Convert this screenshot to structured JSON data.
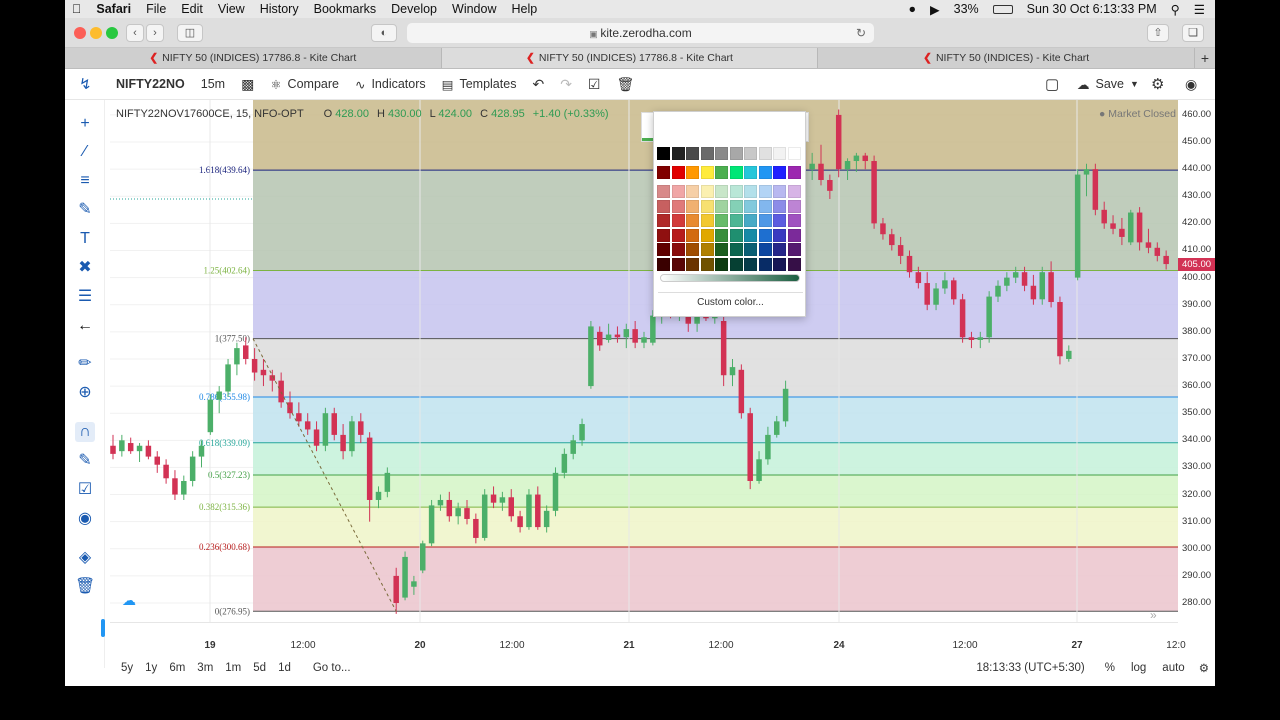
{
  "menubar": {
    "apple": "",
    "app": "Safari",
    "items": [
      "File",
      "Edit",
      "View",
      "History",
      "Bookmarks",
      "Develop",
      "Window",
      "Help"
    ],
    "battery": "33%",
    "datetime": "Sun 30 Oct  6:13:33 PM"
  },
  "browser": {
    "url": "kite.zerodha.com",
    "tabs": [
      {
        "label": "NIFTY 50 (INDICES) 17786.8 - Kite Chart"
      },
      {
        "label": "NIFTY 50 (INDICES) 17786.8 - Kite Chart"
      },
      {
        "label": "NIFTY 50 (INDICES) - Kite Chart"
      }
    ]
  },
  "toolbar": {
    "symbol": "NIFTY22NO",
    "interval": "15m",
    "compare": "Compare",
    "indicators": "Indicators",
    "templates": "Templates",
    "save": "Save"
  },
  "legend": {
    "instrument": "NIFTY22NOV17600CE, 15, NFO-OPT",
    "o_label": "O",
    "o": "428.00",
    "h_label": "H",
    "h": "430.00",
    "l_label": "L",
    "l": "424.00",
    "c_label": "C",
    "c": "428.95",
    "change": "+1.40 (+0.33%)",
    "status": "Market Closed"
  },
  "fib_levels": [
    {
      "ratio": "1.618",
      "price": 439.64,
      "label": "1.618(439.64)",
      "color": "#1a237e",
      "fill": "#c8b98a"
    },
    {
      "ratio": "1.25",
      "price": 402.64,
      "label": "1.25(402.64)",
      "color": "#7cb342",
      "fill": "#b5c4b0"
    },
    {
      "ratio": "1",
      "price": 377.5,
      "label": "1(377.50)",
      "color": "#555555",
      "fill": "#c5c3ef"
    },
    {
      "ratio": "0.786",
      "price": 355.98,
      "label": "0.786(355.98)",
      "color": "#1e88e5",
      "fill": "#dcdcdc"
    },
    {
      "ratio": "0.618",
      "price": 339.09,
      "label": "0.618(339.09)",
      "color": "#26a69a",
      "fill": "#bfe3ee"
    },
    {
      "ratio": "0.5",
      "price": 327.23,
      "label": "0.5(327.23)",
      "color": "#43a047",
      "fill": "#c4f1d9"
    },
    {
      "ratio": "0.382",
      "price": 315.36,
      "label": "0.382(315.36)",
      "color": "#7cb342",
      "fill": "#d3f5c6"
    },
    {
      "ratio": "0.236",
      "price": 300.68,
      "label": "0.236(300.68)",
      "color": "#b71c1c",
      "fill": "#eef5c8"
    },
    {
      "ratio": "0",
      "price": 276.95,
      "label": "0(276.95)",
      "color": "#555555",
      "fill": "#ebc4cc"
    }
  ],
  "price_axis": [
    "460.00",
    "450.00",
    "440.00",
    "430.00",
    "420.00",
    "410.00",
    "400.00",
    "390.00",
    "380.00",
    "370.00",
    "360.00",
    "350.00",
    "340.00",
    "330.00",
    "320.00",
    "310.00",
    "300.00",
    "290.00",
    "280.00"
  ],
  "current_price": "405.00",
  "time_axis": [
    "19",
    "12:00",
    "20",
    "12:00",
    "21",
    "12:00",
    "24",
    "12:00",
    "27",
    "12:0"
  ],
  "bottom": {
    "ranges": [
      "5y",
      "1y",
      "6m",
      "3m",
      "1m",
      "5d",
      "1d"
    ],
    "goto": "Go to...",
    "clock": "18:13:33 (UTC+5:30)",
    "pct": "%",
    "log": "log",
    "auto": "auto"
  },
  "palette": {
    "custom": "Custom color...",
    "grays": [
      "#000000",
      "#222222",
      "#4a4a4a",
      "#6a6a6a",
      "#8a8a8a",
      "#a8a8a8",
      "#c8c8c8",
      "#e0e0e0",
      "#f2f2f2",
      "#ffffff"
    ],
    "main": [
      "#800000",
      "#e00000",
      "#ff9800",
      "#ffeb3b",
      "#4caf50",
      "#00e676",
      "#26c6da",
      "#2196f3",
      "#2020ff",
      "#9c27b0",
      "#e040fb"
    ],
    "shades": [
      [
        "#d88a8a",
        "#f0a6a6",
        "#f6cfa6",
        "#fbf0b0",
        "#c8e6c9",
        "#b9e7d7",
        "#b3e0ea",
        "#b3d4f5",
        "#b8b8f0",
        "#d7b4e6"
      ],
      [
        "#c76060",
        "#e07a7a",
        "#f0b070",
        "#f7e070",
        "#9fd39f",
        "#84d0b6",
        "#82c9dd",
        "#82b7ee",
        "#8c8ce8",
        "#bd84d4"
      ],
      [
        "#b02a2a",
        "#d23a3a",
        "#e88a30",
        "#f2c830",
        "#66bb6a",
        "#4db694",
        "#48aac6",
        "#4f98e6",
        "#5c5ce0",
        "#a052c0"
      ],
      [
        "#8f1010",
        "#b71c1c",
        "#d26a10",
        "#e0a800",
        "#388e3c",
        "#1f8f70",
        "#178aa6",
        "#1e6fd0",
        "#3a3ac0",
        "#7b2a9a"
      ],
      [
        "#600000",
        "#8a0c0c",
        "#a04d00",
        "#b08000",
        "#1b5e20",
        "#0d6650",
        "#0a5f75",
        "#0d47a1",
        "#26268a",
        "#551a70"
      ],
      [
        "#3a0000",
        "#5a0606",
        "#6a3300",
        "#705200",
        "#0d3b10",
        "#064033",
        "#063c4a",
        "#082c66",
        "#161655",
        "#360f47"
      ]
    ]
  },
  "candles": [
    {
      "t": 0,
      "o": 338,
      "h": 342,
      "l": 333,
      "c": 335
    },
    {
      "t": 1,
      "o": 336,
      "h": 342,
      "l": 334,
      "c": 340
    },
    {
      "t": 2,
      "o": 339,
      "h": 341,
      "l": 335,
      "c": 336
    },
    {
      "t": 3,
      "o": 336,
      "h": 339,
      "l": 332,
      "c": 338
    },
    {
      "t": 4,
      "o": 338,
      "h": 340,
      "l": 333,
      "c": 334
    },
    {
      "t": 5,
      "o": 334,
      "h": 336,
      "l": 328,
      "c": 331
    },
    {
      "t": 6,
      "o": 331,
      "h": 333,
      "l": 324,
      "c": 326
    },
    {
      "t": 7,
      "o": 326,
      "h": 329,
      "l": 318,
      "c": 320
    },
    {
      "t": 8,
      "o": 320,
      "h": 327,
      "l": 318,
      "c": 325
    },
    {
      "t": 9,
      "o": 325,
      "h": 336,
      "l": 323,
      "c": 334
    },
    {
      "t": 10,
      "o": 334,
      "h": 340,
      "l": 330,
      "c": 338
    },
    {
      "t": 11,
      "o": 343,
      "h": 357,
      "l": 342,
      "c": 355
    },
    {
      "t": 12,
      "o": 355,
      "h": 360,
      "l": 350,
      "c": 358
    },
    {
      "t": 13,
      "o": 358,
      "h": 370,
      "l": 356,
      "c": 368
    },
    {
      "t": 14,
      "o": 368,
      "h": 376,
      "l": 364,
      "c": 374
    },
    {
      "t": 15,
      "o": 375,
      "h": 378,
      "l": 368,
      "c": 370
    },
    {
      "t": 16,
      "o": 370,
      "h": 374,
      "l": 362,
      "c": 365
    },
    {
      "t": 17,
      "o": 366,
      "h": 370,
      "l": 360,
      "c": 364
    },
    {
      "t": 18,
      "o": 364,
      "h": 366,
      "l": 358,
      "c": 362
    },
    {
      "t": 19,
      "o": 362,
      "h": 365,
      "l": 352,
      "c": 354
    },
    {
      "t": 20,
      "o": 354,
      "h": 358,
      "l": 348,
      "c": 350
    },
    {
      "t": 21,
      "o": 350,
      "h": 354,
      "l": 345,
      "c": 347
    },
    {
      "t": 22,
      "o": 347,
      "h": 350,
      "l": 342,
      "c": 344
    },
    {
      "t": 23,
      "o": 344,
      "h": 347,
      "l": 336,
      "c": 338
    },
    {
      "t": 24,
      "o": 338,
      "h": 352,
      "l": 336,
      "c": 350
    },
    {
      "t": 25,
      "o": 350,
      "h": 352,
      "l": 340,
      "c": 342
    },
    {
      "t": 26,
      "o": 342,
      "h": 346,
      "l": 333,
      "c": 336
    },
    {
      "t": 27,
      "o": 336,
      "h": 349,
      "l": 334,
      "c": 347
    },
    {
      "t": 28,
      "o": 347,
      "h": 350,
      "l": 339,
      "c": 342
    },
    {
      "t": 29,
      "o": 341,
      "h": 343,
      "l": 310,
      "c": 318
    },
    {
      "t": 30,
      "o": 318,
      "h": 323,
      "l": 315,
      "c": 321
    },
    {
      "t": 31,
      "o": 321,
      "h": 330,
      "l": 319,
      "c": 328
    },
    {
      "t": 32,
      "o": 290,
      "h": 293,
      "l": 276,
      "c": 280
    },
    {
      "t": 33,
      "o": 282,
      "h": 299,
      "l": 281,
      "c": 297
    },
    {
      "t": 34,
      "o": 286,
      "h": 290,
      "l": 283,
      "c": 288
    },
    {
      "t": 35,
      "o": 292,
      "h": 303,
      "l": 291,
      "c": 302
    },
    {
      "t": 36,
      "o": 302,
      "h": 318,
      "l": 301,
      "c": 316
    },
    {
      "t": 37,
      "o": 316,
      "h": 320,
      "l": 314,
      "c": 318
    },
    {
      "t": 38,
      "o": 318,
      "h": 321,
      "l": 310,
      "c": 312
    },
    {
      "t": 39,
      "o": 312,
      "h": 317,
      "l": 309,
      "c": 315
    },
    {
      "t": 40,
      "o": 315,
      "h": 318,
      "l": 309,
      "c": 311
    },
    {
      "t": 41,
      "o": 311,
      "h": 313,
      "l": 302,
      "c": 304
    },
    {
      "t": 42,
      "o": 304,
      "h": 322,
      "l": 303,
      "c": 320
    },
    {
      "t": 43,
      "o": 320,
      "h": 323,
      "l": 315,
      "c": 317
    },
    {
      "t": 44,
      "o": 317,
      "h": 321,
      "l": 314,
      "c": 319
    },
    {
      "t": 45,
      "o": 319,
      "h": 322,
      "l": 310,
      "c": 312
    },
    {
      "t": 46,
      "o": 312,
      "h": 314,
      "l": 306,
      "c": 308
    },
    {
      "t": 47,
      "o": 308,
      "h": 322,
      "l": 307,
      "c": 320
    },
    {
      "t": 48,
      "o": 320,
      "h": 323,
      "l": 307,
      "c": 308
    },
    {
      "t": 49,
      "o": 308,
      "h": 316,
      "l": 306,
      "c": 314
    },
    {
      "t": 50,
      "o": 314,
      "h": 330,
      "l": 312,
      "c": 328
    },
    {
      "t": 51,
      "o": 328,
      "h": 337,
      "l": 326,
      "c": 335
    },
    {
      "t": 52,
      "o": 335,
      "h": 342,
      "l": 333,
      "c": 340
    },
    {
      "t": 53,
      "o": 340,
      "h": 348,
      "l": 338,
      "c": 346
    },
    {
      "t": 54,
      "o": 360,
      "h": 384,
      "l": 359,
      "c": 382
    },
    {
      "t": 55,
      "o": 380,
      "h": 382,
      "l": 373,
      "c": 375
    },
    {
      "t": 56,
      "o": 377,
      "h": 383,
      "l": 376,
      "c": 379
    },
    {
      "t": 57,
      "o": 379,
      "h": 382,
      "l": 376,
      "c": 378
    },
    {
      "t": 58,
      "o": 378,
      "h": 383,
      "l": 374,
      "c": 381
    },
    {
      "t": 59,
      "o": 381,
      "h": 384,
      "l": 374,
      "c": 376
    },
    {
      "t": 60,
      "o": 376,
      "h": 380,
      "l": 374,
      "c": 378
    },
    {
      "t": 61,
      "o": 376,
      "h": 388,
      "l": 375,
      "c": 386
    },
    {
      "t": 62,
      "o": 386,
      "h": 390,
      "l": 383,
      "c": 388
    },
    {
      "t": 63,
      "o": 388,
      "h": 390,
      "l": 385,
      "c": 387
    },
    {
      "t": 64,
      "o": 387,
      "h": 390,
      "l": 384,
      "c": 388
    },
    {
      "t": 65,
      "o": 388,
      "h": 390,
      "l": 380,
      "c": 383
    },
    {
      "t": 66,
      "o": 383,
      "h": 388,
      "l": 380,
      "c": 386
    },
    {
      "t": 67,
      "o": 386,
      "h": 390,
      "l": 384,
      "c": 385
    },
    {
      "t": 68,
      "o": 385,
      "h": 390,
      "l": 383,
      "c": 388
    },
    {
      "t": 69,
      "o": 384,
      "h": 386,
      "l": 360,
      "c": 364
    },
    {
      "t": 70,
      "o": 364,
      "h": 370,
      "l": 360,
      "c": 367
    },
    {
      "t": 71,
      "o": 366,
      "h": 368,
      "l": 348,
      "c": 350
    },
    {
      "t": 72,
      "o": 350,
      "h": 352,
      "l": 322,
      "c": 325
    },
    {
      "t": 73,
      "o": 325,
      "h": 336,
      "l": 324,
      "c": 333
    },
    {
      "t": 74,
      "o": 333,
      "h": 345,
      "l": 331,
      "c": 342
    },
    {
      "t": 75,
      "o": 342,
      "h": 349,
      "l": 341,
      "c": 347
    },
    {
      "t": 76,
      "o": 347,
      "h": 362,
      "l": 345,
      "c": 359
    },
    {
      "t": 77,
      "o": 430,
      "h": 450,
      "l": 425,
      "c": 447
    },
    {
      "t": 78,
      "o": 447,
      "h": 450,
      "l": 437,
      "c": 440
    },
    {
      "t": 79,
      "o": 440,
      "h": 446,
      "l": 436,
      "c": 442
    },
    {
      "t": 80,
      "o": 442,
      "h": 449,
      "l": 434,
      "c": 436
    },
    {
      "t": 81,
      "o": 436,
      "h": 438,
      "l": 429,
      "c": 432
    },
    {
      "t": 82,
      "o": 460,
      "h": 462,
      "l": 437,
      "c": 440
    },
    {
      "t": 83,
      "o": 440,
      "h": 444,
      "l": 436,
      "c": 443
    },
    {
      "t": 84,
      "o": 443,
      "h": 446,
      "l": 439,
      "c": 445
    },
    {
      "t": 85,
      "o": 445,
      "h": 446,
      "l": 440,
      "c": 443
    },
    {
      "t": 86,
      "o": 443,
      "h": 445,
      "l": 418,
      "c": 420
    },
    {
      "t": 87,
      "o": 420,
      "h": 422,
      "l": 414,
      "c": 416
    },
    {
      "t": 88,
      "o": 416,
      "h": 418,
      "l": 410,
      "c": 412
    },
    {
      "t": 89,
      "o": 412,
      "h": 415,
      "l": 405,
      "c": 408
    },
    {
      "t": 90,
      "o": 408,
      "h": 410,
      "l": 400,
      "c": 402
    },
    {
      "t": 91,
      "o": 402,
      "h": 404,
      "l": 396,
      "c": 398
    },
    {
      "t": 92,
      "o": 398,
      "h": 402,
      "l": 388,
      "c": 390
    },
    {
      "t": 93,
      "o": 390,
      "h": 398,
      "l": 388,
      "c": 396
    },
    {
      "t": 94,
      "o": 396,
      "h": 402,
      "l": 394,
      "c": 399
    },
    {
      "t": 95,
      "o": 399,
      "h": 400,
      "l": 390,
      "c": 392
    },
    {
      "t": 96,
      "o": 392,
      "h": 394,
      "l": 376,
      "c": 378
    },
    {
      "t": 97,
      "o": 378,
      "h": 380,
      "l": 374,
      "c": 377
    },
    {
      "t": 98,
      "o": 377,
      "h": 380,
      "l": 374,
      "c": 378
    },
    {
      "t": 99,
      "o": 378,
      "h": 395,
      "l": 376,
      "c": 393
    },
    {
      "t": 100,
      "o": 393,
      "h": 399,
      "l": 391,
      "c": 397
    },
    {
      "t": 101,
      "o": 397,
      "h": 402,
      "l": 395,
      "c": 400
    },
    {
      "t": 102,
      "o": 400,
      "h": 404,
      "l": 398,
      "c": 402
    },
    {
      "t": 103,
      "o": 402,
      "h": 404,
      "l": 395,
      "c": 397
    },
    {
      "t": 104,
      "o": 397,
      "h": 401,
      "l": 390,
      "c": 392
    },
    {
      "t": 105,
      "o": 392,
      "h": 404,
      "l": 390,
      "c": 402
    },
    {
      "t": 106,
      "o": 402,
      "h": 406,
      "l": 389,
      "c": 391
    },
    {
      "t": 107,
      "o": 391,
      "h": 393,
      "l": 368,
      "c": 371
    },
    {
      "t": 108,
      "o": 370,
      "h": 375,
      "l": 369,
      "c": 373
    },
    {
      "t": 109,
      "o": 400,
      "h": 440,
      "l": 399,
      "c": 438
    },
    {
      "t": 110,
      "o": 438,
      "h": 442,
      "l": 430,
      "c": 440
    },
    {
      "t": 111,
      "o": 440,
      "h": 442,
      "l": 423,
      "c": 425
    },
    {
      "t": 112,
      "o": 425,
      "h": 428,
      "l": 418,
      "c": 420
    },
    {
      "t": 113,
      "o": 420,
      "h": 423,
      "l": 416,
      "c": 418
    },
    {
      "t": 114,
      "o": 418,
      "h": 422,
      "l": 412,
      "c": 415
    },
    {
      "t": 115,
      "o": 413,
      "h": 425,
      "l": 412,
      "c": 424
    },
    {
      "t": 116,
      "o": 424,
      "h": 426,
      "l": 410,
      "c": 413
    },
    {
      "t": 117,
      "o": 413,
      "h": 418,
      "l": 409,
      "c": 411
    },
    {
      "t": 118,
      "o": 411,
      "h": 413,
      "l": 406,
      "c": 408
    },
    {
      "t": 119,
      "o": 408,
      "h": 410,
      "l": 403,
      "c": 405
    }
  ]
}
